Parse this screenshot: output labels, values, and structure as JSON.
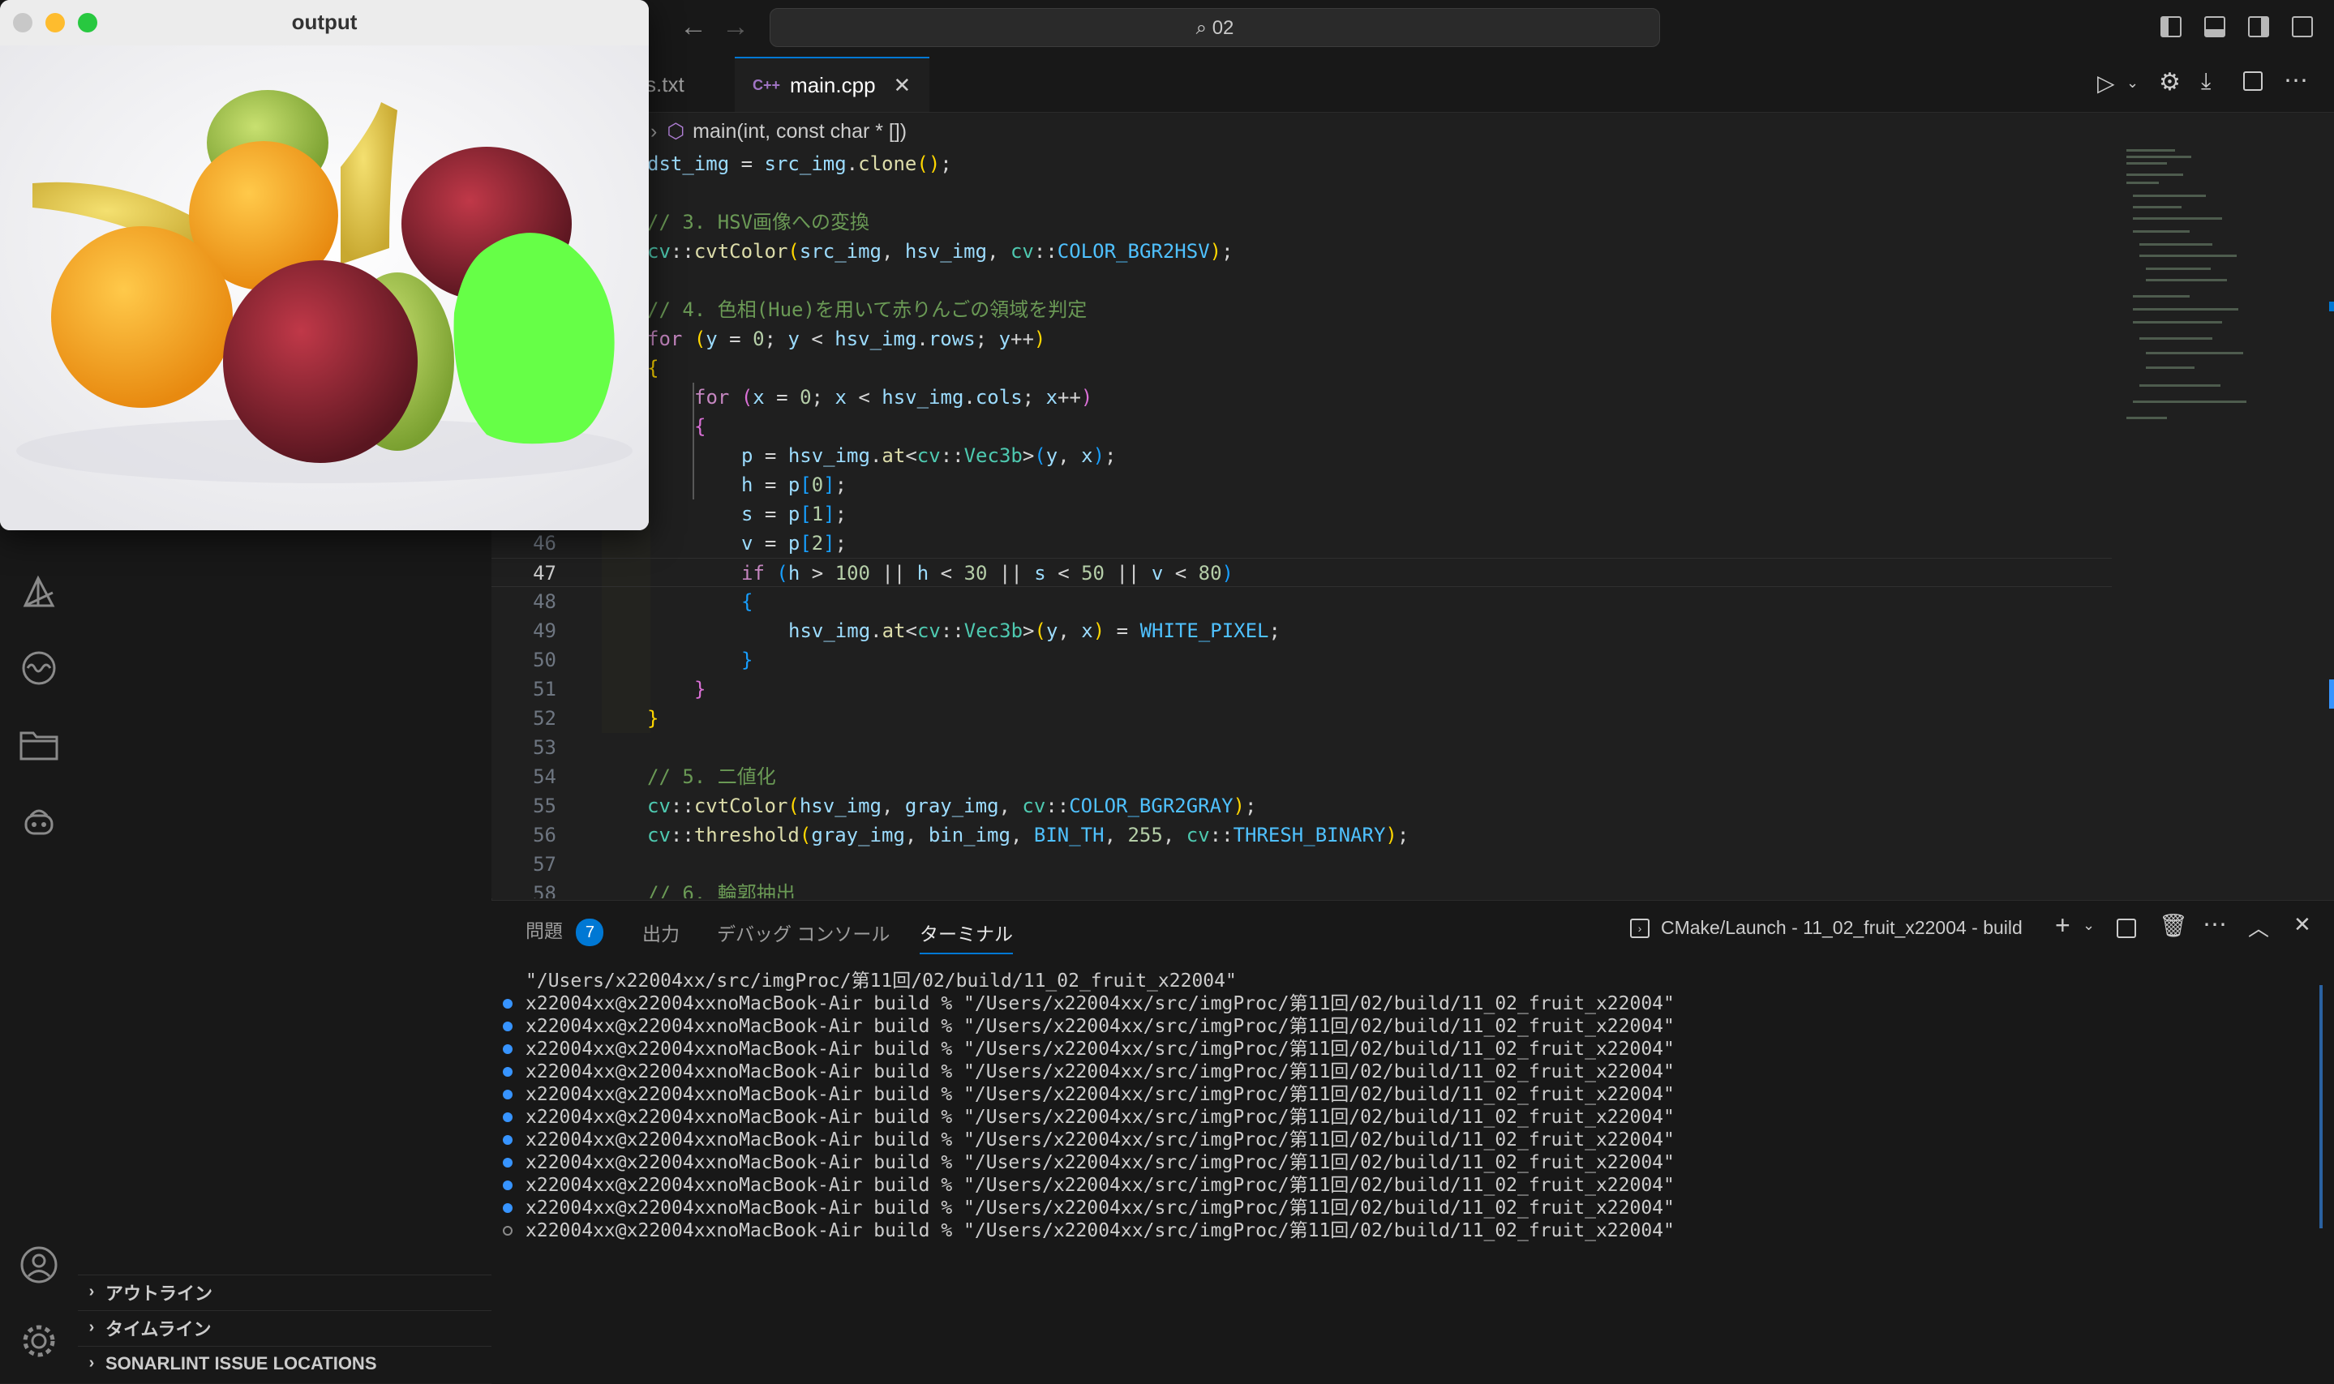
{
  "titlebar": {
    "search_text": "02",
    "search_icon": "search-icon"
  },
  "tabs": [
    {
      "label": "s.txt"
    },
    {
      "label": "main.cpp",
      "icon": "C++",
      "active": true
    }
  ],
  "breadcrumb": {
    "symbol": "main(int, const char * [])"
  },
  "code": {
    "line_numbers": [
      "46",
      "47",
      "48",
      "49",
      "50",
      "51",
      "52",
      "53",
      "54",
      "55",
      "56",
      "57",
      "58"
    ],
    "current_line": "47"
  },
  "panel": {
    "tabs": [
      {
        "label": "問題",
        "badge": "7"
      },
      {
        "label": "出力"
      },
      {
        "label": "デバッグ コンソール"
      },
      {
        "label": "ターミナル",
        "active": true
      }
    ],
    "terminal_name": "CMake/Launch - 11_02_fruit_x22004 - build",
    "terminal_lines": [
      "\"/Users/x22004xx/src/imgProc/第11回/02/build/11_02_fruit_x22004\"",
      "x22004xx@x22004xxnoMacBook-Air build % \"/Users/x22004xx/src/imgProc/第11回/02/build/11_02_fruit_x22004\"",
      "x22004xx@x22004xxnoMacBook-Air build % \"/Users/x22004xx/src/imgProc/第11回/02/build/11_02_fruit_x22004\"",
      "x22004xx@x22004xxnoMacBook-Air build % \"/Users/x22004xx/src/imgProc/第11回/02/build/11_02_fruit_x22004\"",
      "x22004xx@x22004xxnoMacBook-Air build % \"/Users/x22004xx/src/imgProc/第11回/02/build/11_02_fruit_x22004\"",
      "x22004xx@x22004xxnoMacBook-Air build % \"/Users/x22004xx/src/imgProc/第11回/02/build/11_02_fruit_x22004\"",
      "x22004xx@x22004xxnoMacBook-Air build % \"/Users/x22004xx/src/imgProc/第11回/02/build/11_02_fruit_x22004\"",
      "x22004xx@x22004xxnoMacBook-Air build % \"/Users/x22004xx/src/imgProc/第11回/02/build/11_02_fruit_x22004\"",
      "x22004xx@x22004xxnoMacBook-Air build % \"/Users/x22004xx/src/imgProc/第11回/02/build/11_02_fruit_x22004\"",
      "x22004xx@x22004xxnoMacBook-Air build % \"/Users/x22004xx/src/imgProc/第11回/02/build/11_02_fruit_x22004\"",
      "x22004xx@x22004xxnoMacBook-Air build % \"/Users/x22004xx/src/imgProc/第11回/02/build/11_02_fruit_x22004\"",
      "x22004xx@x22004xxnoMacBook-Air build % \"/Users/x22004xx/src/imgProc/第11回/02/build/11_02_fruit_x22004\""
    ]
  },
  "sidebar": {
    "sections": [
      {
        "label": "アウトライン"
      },
      {
        "label": "タイムライン"
      },
      {
        "label": "SONARLINT ISSUE LOCATIONS"
      }
    ]
  },
  "output_window": {
    "title": "output"
  },
  "colors": {
    "accent": "#0078d4",
    "background": "#1f1f1f",
    "sidebar": "#181818",
    "badge": "#0078d4",
    "apple_mask": "#66ff47"
  }
}
